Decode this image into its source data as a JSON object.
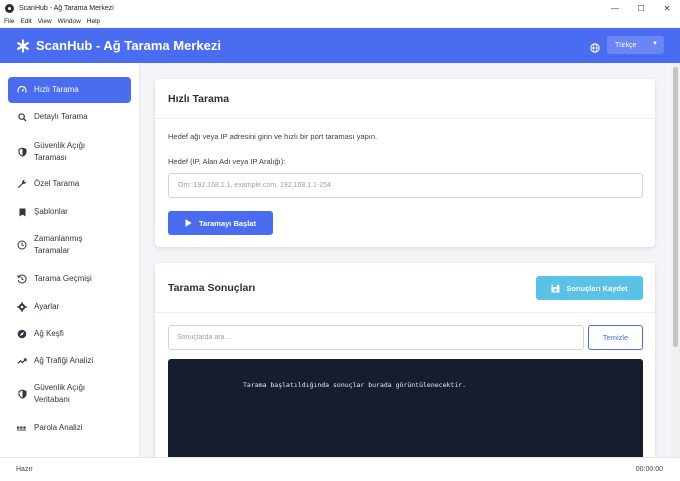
{
  "window": {
    "title": "ScanHub - Ağ Tarama Merkezi",
    "controls": {
      "minimize": "—",
      "maximize": "☐",
      "close": "✕"
    }
  },
  "menubar": {
    "items": [
      "File",
      "Edit",
      "View",
      "Window",
      "Help"
    ]
  },
  "header": {
    "title": "ScanHub - Ağ Tarama Merkezi",
    "language": "Türkçe",
    "accent_color": "#4a6cf0"
  },
  "sidebar": {
    "items": [
      {
        "label": "Hızlı Tarama",
        "icon": "gauge-icon",
        "active": true
      },
      {
        "label": "Detaylı Tarama",
        "icon": "search-icon"
      },
      {
        "label": "Güvenlik Açığı Taraması",
        "icon": "shield-icon"
      },
      {
        "label": "Özel Tarama",
        "icon": "wrench-icon"
      },
      {
        "label": "Şablonlar",
        "icon": "bookmark-icon"
      },
      {
        "label": "Zamanlanmış Taramalar",
        "icon": "clock-icon"
      },
      {
        "label": "Tarama Geçmişi",
        "icon": "history-icon"
      },
      {
        "label": "Ayarlar",
        "icon": "gear-icon"
      },
      {
        "label": "Ağ Keşfi",
        "icon": "compass-icon"
      },
      {
        "label": "Ağ Trafiği Analizi",
        "icon": "chart-line-icon"
      },
      {
        "label": "Güvenlik Açığı Veritabanı",
        "icon": "shield-icon"
      },
      {
        "label": "Parola Analizi",
        "icon": "password-icon"
      }
    ]
  },
  "quick_scan": {
    "title": "Hızlı Tarama",
    "description": "Hedef ağı veya IP adresini girin ve hızlı bir port taraması yapın.",
    "target_label": "Hedef (IP, Alan Adı veya IP Aralığı):",
    "target_value": "",
    "target_placeholder": "Örn: 192.168.1.1, example.com, 192.168.1.1-254",
    "start_button": "Taramayı Başlat"
  },
  "results": {
    "title": "Tarama Sonuçları",
    "save_button": "Sonuçları Kaydet",
    "search_value": "",
    "search_placeholder": "Sonuçlarda ara...",
    "clear_button": "Temizle",
    "console_text": "Tarama başlatıldığında sonuçlar burada görüntülenecektir."
  },
  "statusbar": {
    "status": "Hazır",
    "timer": "00:00:00"
  }
}
